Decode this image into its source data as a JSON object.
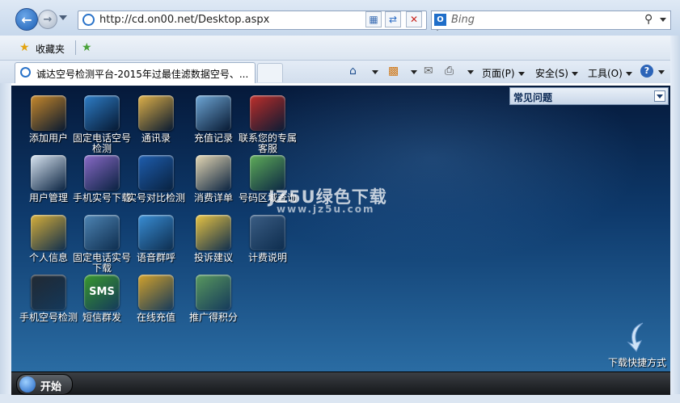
{
  "browser": {
    "address": {
      "url": "http://cd.on00.net/Desktop.aspx"
    },
    "search": {
      "placeholder": "Bing",
      "logo": "Bing"
    },
    "favorites": {
      "label": "收藏夹"
    },
    "tab": {
      "title": "诚达空号检测平台-2015年过最佳滤数据空号、..."
    },
    "commands": {
      "page": "页面(P)",
      "safety": "安全(S)",
      "tools": "工具(O)",
      "help": "?"
    }
  },
  "desktop": {
    "icons": [
      {
        "label": "添加用户",
        "icon": "users-icon",
        "color": "#c98a2c"
      },
      {
        "label": "固定电话空号检测",
        "icon": "telephone-icon",
        "color": "#2f7fc9"
      },
      {
        "label": "通讯录",
        "icon": "address-book-icon",
        "color": "#e0b24a"
      },
      {
        "label": "充值记录",
        "icon": "card-icon",
        "color": "#6fa8d8"
      },
      {
        "label": "联系您的专属客服",
        "icon": "phone-handset-icon",
        "color": "#c0302c"
      },
      {
        "label": "用户管理",
        "icon": "user-card-icon",
        "color": "#d9e6f3"
      },
      {
        "label": "手机实号下载",
        "icon": "mobile-phone-icon",
        "color": "#8a6bc9"
      },
      {
        "label": "实号对比检测",
        "icon": "magnifier-icon",
        "color": "#1f5fb0"
      },
      {
        "label": "消费详单",
        "icon": "clipboard-icon",
        "color": "#e6d9b5"
      },
      {
        "label": "号码区域查询",
        "icon": "map-magnifier-icon",
        "color": "#5fae5a"
      },
      {
        "label": "个人信息",
        "icon": "keys-icon",
        "color": "#d8b03a"
      },
      {
        "label": "固定电话实号下载",
        "icon": "rotary-phone-icon",
        "color": "#4f86b5"
      },
      {
        "label": "语音群呼",
        "icon": "call-icon",
        "color": "#3a8fd6"
      },
      {
        "label": "投诉建议",
        "icon": "envelope-icon",
        "color": "#e9c544"
      },
      {
        "label": "计费说明",
        "icon": "settings-monitor-icon",
        "color": "#3c5f86"
      },
      {
        "label": "手机空号检测",
        "icon": "smartphone-icon",
        "color": "#222a33"
      },
      {
        "label": "短信群发",
        "icon": "sms-icon",
        "color": "#3a9a2e"
      },
      {
        "label": "在线充值",
        "icon": "coins-icon",
        "color": "#d4a32c"
      },
      {
        "label": "推广得积分",
        "icon": "user-book-icon",
        "color": "#5a9a5f"
      }
    ],
    "faq": {
      "title": "常见问题"
    },
    "watermark": {
      "line1": "JZ5U绿色下载",
      "line2": "www.jz5u.com"
    },
    "shortcut": {
      "label": "下载快捷方式"
    }
  },
  "taskbar": {
    "start_label": "开始"
  }
}
